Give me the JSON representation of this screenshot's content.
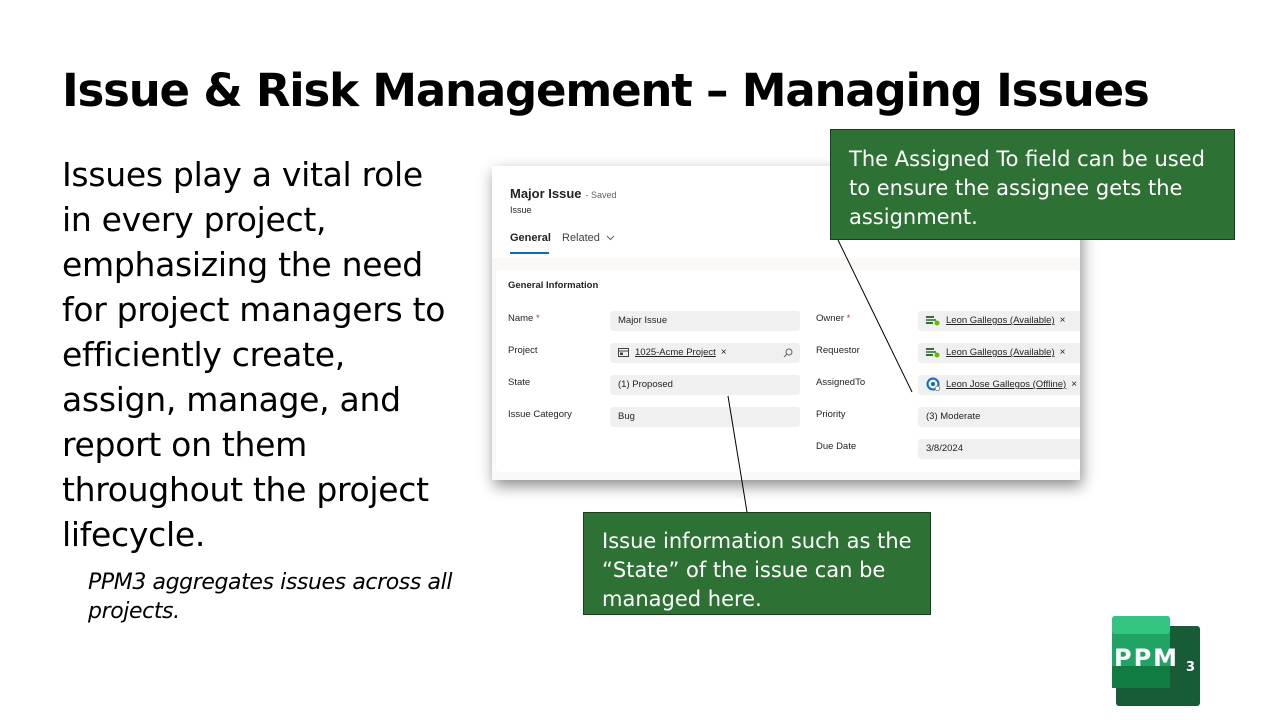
{
  "slide": {
    "title": "Issue & Risk Management – Managing Issues",
    "body": "Issues play a vital role in every project, emphasizing the need for project managers to efficiently create, assign, manage, and report on them throughout the project lifecycle.",
    "note": "PPM3 aggregates issues across all projects."
  },
  "form": {
    "record_title": "Major Issue",
    "saved_status": "- Saved",
    "record_type": "Issue",
    "tabs": [
      {
        "label": "General"
      },
      {
        "label": "Related"
      }
    ],
    "section_title": "General Information",
    "required_marker": "*",
    "fields": {
      "name": {
        "label": "Name",
        "value": "Major Issue"
      },
      "project": {
        "label": "Project",
        "value": "1025-Acme Project"
      },
      "state": {
        "label": "State",
        "value": "(1) Proposed"
      },
      "issue_category": {
        "label": "Issue Category",
        "value": "Bug"
      },
      "owner": {
        "label": "Owner",
        "value": "Leon Gallegos (Available)"
      },
      "requestor": {
        "label": "Requestor",
        "value": "Leon Gallegos (Available)"
      },
      "assigned_to": {
        "label": "AssignedTo",
        "value": "Leon Jose Gallegos (Offline)"
      },
      "priority": {
        "label": "Priority",
        "value": "(3) Moderate"
      },
      "due_date": {
        "label": "Due Date",
        "value": "3/8/2024"
      }
    },
    "clear_glyph": "×"
  },
  "callouts": {
    "assigned_to": "The Assigned To field can be used to ensure the assignee gets the assignment.",
    "issue_info": "Issue information such as the “State” of the issue can be managed here."
  },
  "logo": {
    "text": "PPM",
    "sub": "3"
  },
  "colors": {
    "callout_green": "#2e7134",
    "accent_blue": "#0f6cbd",
    "logo_green": "#21a366",
    "logo_dark": "#185c37"
  }
}
